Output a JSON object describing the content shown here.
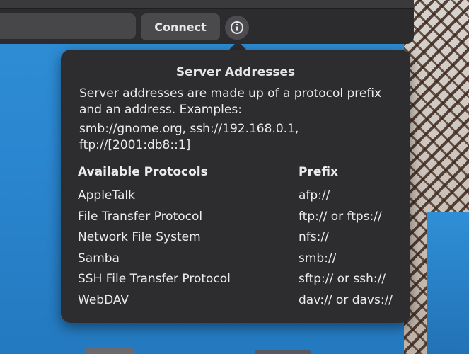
{
  "toolbar": {
    "address_value": "",
    "connect_label": "Connect",
    "info_icon": "info-icon"
  },
  "popover": {
    "title": "Server Addresses",
    "description": "Server addresses are made up of a protocol prefix and an address. Examples:",
    "examples": "smb://gnome.org, ssh://192.168.0.1, ftp://[2001:db8::1]",
    "table": {
      "header": {
        "protocol": "Available Protocols",
        "prefix": "Prefix"
      },
      "rows": [
        {
          "protocol": "AppleTalk",
          "prefix": "afp://"
        },
        {
          "protocol": "File Transfer Protocol",
          "prefix": "ftp:// or ftps://"
        },
        {
          "protocol": "Network File System",
          "prefix": "nfs://"
        },
        {
          "protocol": "Samba",
          "prefix": "smb://"
        },
        {
          "protocol": "SSH File Transfer Protocol",
          "prefix": "sftp:// or ssh://"
        },
        {
          "protocol": "WebDAV",
          "prefix": "dav:// or davs://"
        }
      ]
    }
  },
  "colors": {
    "popover_bg": "#2d2d30",
    "button_bg": "#4a4a4d",
    "desktop_bg": "#2f8fd6"
  }
}
